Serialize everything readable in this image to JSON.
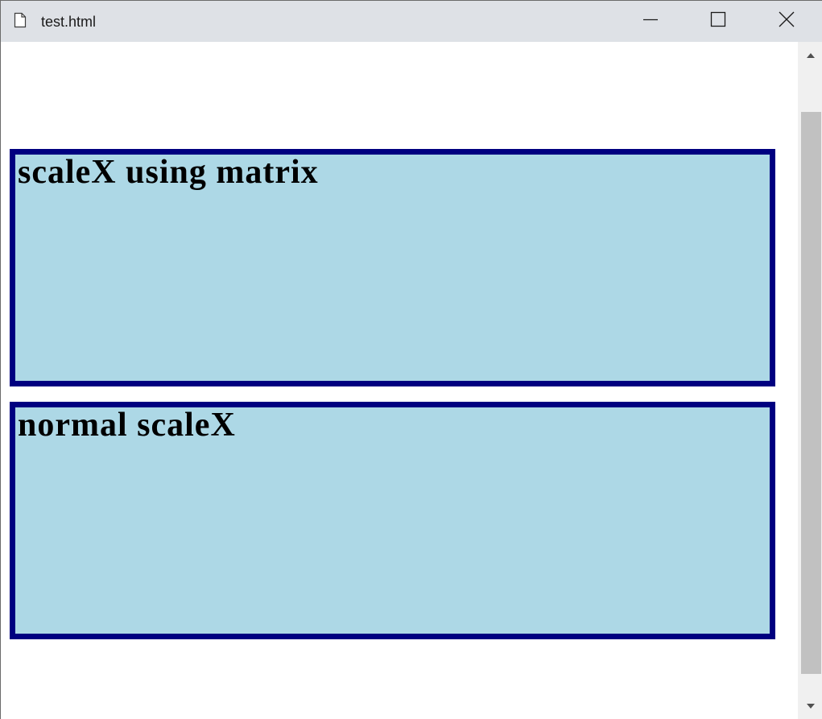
{
  "window": {
    "title": "test.html",
    "icons": {
      "file": "file-icon",
      "minimize": "minimize-icon",
      "maximize": "maximize-icon",
      "close": "close-icon"
    }
  },
  "content": {
    "box1": {
      "heading": "scaleX using matrix"
    },
    "box2": {
      "heading": "normal scaleX"
    }
  },
  "colors": {
    "titlebar_bg": "#dee1e6",
    "box_bg": "#add8e6",
    "box_border": "#000080",
    "scroll_thumb": "#c1c1c1",
    "scroll_track": "#f0f0f0"
  },
  "scrollbar": {
    "up_icon": "arrow-up-icon",
    "down_icon": "arrow-down-icon"
  }
}
